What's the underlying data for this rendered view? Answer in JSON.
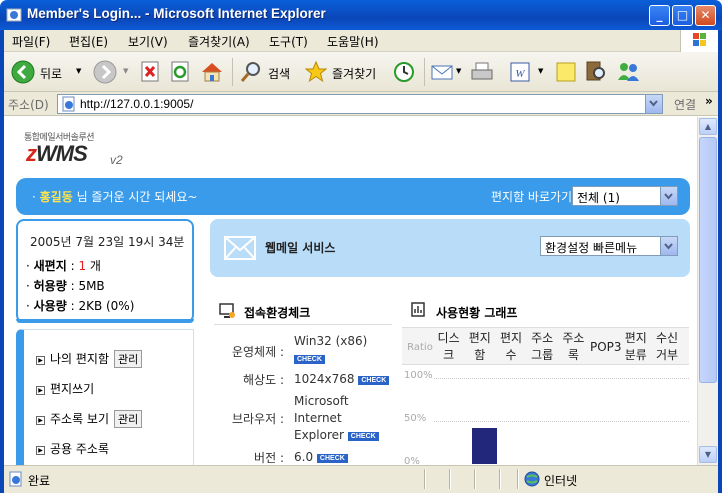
{
  "window": {
    "title": "Member's Login... - Microsoft Internet Explorer",
    "min": "_",
    "max": "□",
    "close": "✕"
  },
  "menu": [
    "파일(F)",
    "편집(E)",
    "보기(V)",
    "즐겨찾기(A)",
    "도구(T)",
    "도움말(H)"
  ],
  "toolbar": {
    "back": "뒤로",
    "search": "검색",
    "favorites": "즐겨찾기"
  },
  "address": {
    "label": "주소(D)",
    "url": "http://127.0.0.1:9005/",
    "go": "연결",
    "more": "»"
  },
  "status": {
    "text": "완료",
    "zone": "인터넷"
  },
  "page": {
    "logo_sub": "통합메일서버솔루션",
    "logo_z": "z",
    "logo_main": "WMS",
    "logo_v2": "v2",
    "greeting_prefix": "· ",
    "user_name": "홍길동",
    "greeting_suffix": " 님 즐거운 시간 되세요~",
    "mailbox_shortcut_label": "편지함 바로가기",
    "mailbox_shortcut_value": "전체 (1)",
    "date": "2005년 7월 23일 19시 34분",
    "new_mail_label": "새편지",
    "new_mail_count": "1",
    "new_mail_unit": " 개",
    "quota_label": "허용량",
    "quota_value": "5MB",
    "used_label": "사용량",
    "used_value": "2KB (0%)",
    "side_menu": [
      {
        "label": "나의 편지함",
        "badge": "관리"
      },
      {
        "label": "편지쓰기",
        "badge": ""
      },
      {
        "label": "주소록 보기",
        "badge": "관리"
      },
      {
        "label": "공용 주소록",
        "badge": ""
      }
    ],
    "webmail_title": "웹메일 서비스",
    "env_settings_value": "환경설정 빠른메뉴",
    "env_check_title": "접속환경체크",
    "env": [
      {
        "key": "운영체제 :",
        "value": "Win32 (x86)"
      },
      {
        "key": "해상도 :",
        "value": "1024x768"
      },
      {
        "key": "브라우저 :",
        "value": "Microsoft Internet Explorer"
      },
      {
        "key": "버전 :",
        "value": "6.0"
      }
    ],
    "check_label": "CHECK",
    "usage_title": "사용현황 그래프",
    "usage_ratio_label": "Ratio",
    "usage_columns": [
      "디스크",
      "편지함",
      "편지수",
      "주소그룹",
      "주소록",
      "POP3",
      "편지분류",
      "수신거부"
    ],
    "usage_y_ticks": [
      "100%",
      "50%",
      "0%"
    ]
  },
  "chart_data": {
    "type": "bar",
    "title": "사용현황 그래프",
    "categories": [
      "디스크",
      "편지함",
      "편지수",
      "주소그룹",
      "주소록",
      "POP3",
      "편지분류",
      "수신거부"
    ],
    "values_percent": [
      null,
      42,
      null,
      null,
      null,
      null,
      null,
      null
    ],
    "ylim": [
      0,
      100
    ],
    "y_ticks": [
      "100%",
      "50%",
      "0%"
    ]
  },
  "colors": {
    "accent": "#3a9bea",
    "light_accent": "#b9dcf8",
    "highlight_name": "#ffe44a",
    "new_count": "#e02020",
    "bar": "#22277b"
  }
}
